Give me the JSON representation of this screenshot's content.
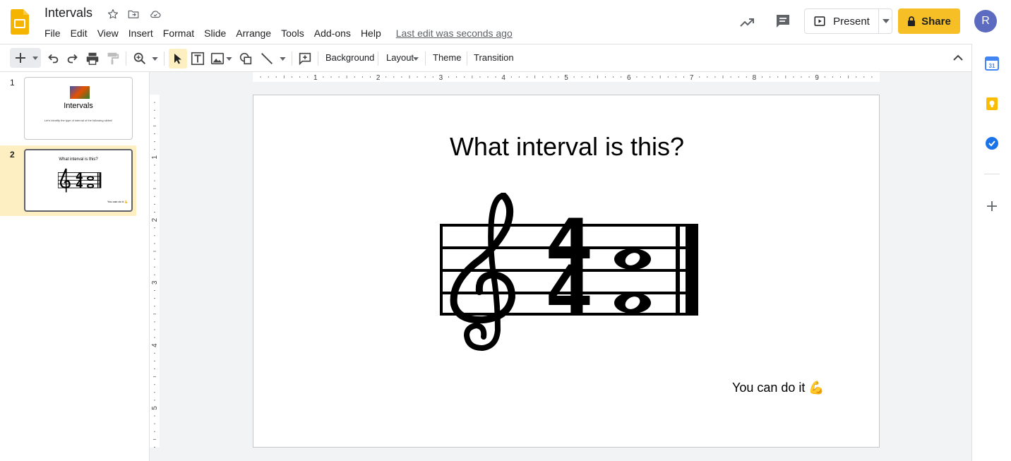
{
  "header": {
    "doc_title": "Intervals",
    "menu": [
      "File",
      "Edit",
      "View",
      "Insert",
      "Format",
      "Slide",
      "Arrange",
      "Tools",
      "Add-ons",
      "Help"
    ],
    "last_edit": "Last edit was seconds ago",
    "present_label": "Present",
    "share_label": "Share",
    "avatar_initial": "R",
    "share_color": "#f6bf26",
    "avatar_color": "#5c6bc0"
  },
  "toolbar": {
    "background_label": "Background",
    "layout_label": "Layout",
    "theme_label": "Theme",
    "transition_label": "Transition"
  },
  "filmstrip": {
    "slides": [
      {
        "number": "1",
        "title": "Intervals",
        "subtitle": "Let's identify the type of interval of the following slides!"
      },
      {
        "number": "2",
        "title": "What interval is this?",
        "footer": "You can do it 💪"
      }
    ],
    "selected": 2,
    "selected_color": "#feefc3"
  },
  "slide": {
    "title": "What interval is this?",
    "footer": "You can do it 💪"
  },
  "rulers": {
    "top_labels": [
      "1",
      "2",
      "3",
      "4",
      "5",
      "6",
      "7",
      "8",
      "9"
    ],
    "left_labels": [
      "1",
      "2",
      "3",
      "4",
      "5"
    ]
  },
  "sidepanel": {
    "icons": [
      "calendar-icon",
      "keep-icon",
      "tasks-icon",
      "add-icon"
    ]
  }
}
